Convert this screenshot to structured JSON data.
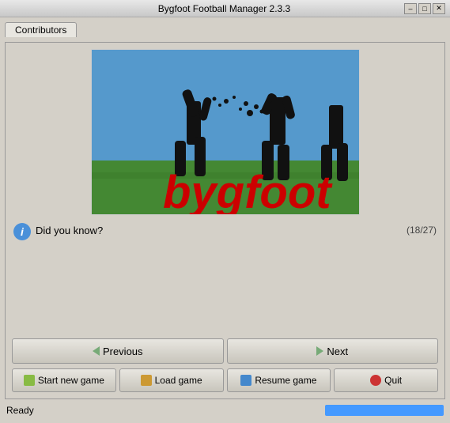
{
  "titlebar": {
    "title": "Bygfoot Football Manager 2.3.3",
    "minimize_label": "–",
    "maximize_label": "□",
    "close_label": "✕"
  },
  "tabs": [
    {
      "label": "Contributors"
    }
  ],
  "logo": {
    "alt": "Bygfoot logo"
  },
  "did_you_know": {
    "label": "Did you know?",
    "icon": "i",
    "count": "(18/27)"
  },
  "nav": {
    "previous_label": "Previous",
    "next_label": "Next"
  },
  "actions": {
    "start_label": "Start new game",
    "load_label": "Load game",
    "resume_label": "Resume game",
    "quit_label": "Quit"
  },
  "status": {
    "text": "Ready",
    "progress_pct": 100
  }
}
